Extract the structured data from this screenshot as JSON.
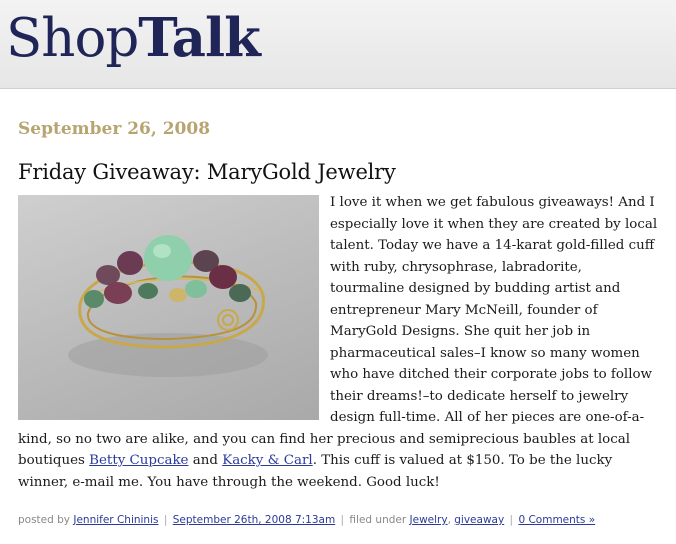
{
  "masthead": {
    "logo_part1": "Shop",
    "logo_part2": "Talk"
  },
  "post": {
    "date": "September 26, 2008",
    "title": "Friday Giveaway: MaryGold Jewelry",
    "image_alt": "Gold-filled cuff with ruby, chrysophrase, labradorite and tourmaline stones",
    "body_intro": "I love it when we get fabulous giveaways! And I especially love it when they are created by local talent. Today we have a 14-karat gold-filled cuff with ruby, chrysophrase, labradorite, tourmaline designed by budding artist and entrepreneur Mary McNeill, founder of MaryGold Designs. She quit her job in pharmaceutical sales–I know so many women who have ditched their corporate jobs to follow their dreams!–to dedicate herself to jewelry design full-time. All of her pieces are one-of-a-kind, so no two are alike, and you can find her precious and semiprecious baubles at local boutiques ",
    "link_betty": "Betty Cupcake",
    "text_and": " and ",
    "link_kacky": "Kacky & Carl",
    "body_outro": ". This cuff is valued at $150. To be the lucky winner, e-mail me. You have through the weekend. Good luck!"
  },
  "meta": {
    "posted_by_label": "posted by ",
    "author": "Jennifer Chininis",
    "separator": "|",
    "timestamp": "September 26th, 2008 7:13am",
    "filed_label": " filed under ",
    "category1": "Jewelry",
    "comma": ", ",
    "category2": "giveaway",
    "comments": "0 Comments »"
  }
}
